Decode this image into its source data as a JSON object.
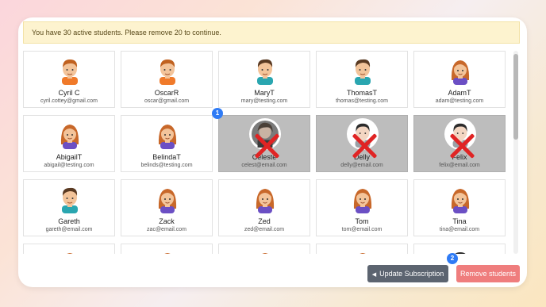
{
  "banner": {
    "text": "You have 30 active students. Please remove 20 to continue."
  },
  "students": [
    {
      "name": "Cyril C",
      "email": "cyril.cottey@gmail.com",
      "avatar": "boy-orange-avatar",
      "removed": false
    },
    {
      "name": "OscarR",
      "email": "oscar@gmail.com",
      "avatar": "boy-orange-avatar",
      "removed": false
    },
    {
      "name": "MaryT",
      "email": "mary@testing.com",
      "avatar": "boy-teal-avatar",
      "removed": false
    },
    {
      "name": "ThomasT",
      "email": "thomas@testing.com",
      "avatar": "boy-teal-avatar",
      "removed": false
    },
    {
      "name": "AdamT",
      "email": "adam@testing.com",
      "avatar": "girl-purple-avatar",
      "removed": false
    },
    {
      "name": "AbigailT",
      "email": "abigail@testing.com",
      "avatar": "girl-purple-avatar",
      "removed": false
    },
    {
      "name": "BelindaT",
      "email": "belinds@testing.com",
      "avatar": "girl-purple-avatar",
      "removed": false
    },
    {
      "name": "Celeste",
      "email": "celest@email.com",
      "avatar": "photo-avatar",
      "removed": true
    },
    {
      "name": "Delly",
      "email": "delly@email.com",
      "avatar": "boy-dark-avatar",
      "removed": true
    },
    {
      "name": "Felix",
      "email": "felix@email.com",
      "avatar": "boy-dark-avatar",
      "removed": true
    },
    {
      "name": "Gareth",
      "email": "gareth@email.com",
      "avatar": "boy-teal-avatar",
      "removed": false
    },
    {
      "name": "Zack",
      "email": "zac@email.com",
      "avatar": "girl-purple-avatar",
      "removed": false
    },
    {
      "name": "Zed",
      "email": "zed@email.com",
      "avatar": "girl-purple-avatar",
      "removed": false
    },
    {
      "name": "Tom",
      "email": "tom@email.com",
      "avatar": "girl-purple-avatar",
      "removed": false
    },
    {
      "name": "Tina",
      "email": "tina@email.com",
      "avatar": "girl-purple-avatar",
      "removed": false
    },
    {
      "name": "",
      "email": "",
      "avatar": "girl-purple-avatar",
      "removed": false
    },
    {
      "name": "",
      "email": "",
      "avatar": "girl-purple-avatar",
      "removed": false
    },
    {
      "name": "",
      "email": "",
      "avatar": "girl-purple-avatar",
      "removed": false
    },
    {
      "name": "",
      "email": "",
      "avatar": "girl-purple-avatar",
      "removed": false
    },
    {
      "name": "",
      "email": "",
      "avatar": "boy-dark-avatar",
      "removed": false
    }
  ],
  "badges": {
    "step1": "1",
    "step2": "2"
  },
  "buttons": {
    "update_label": "Update Subscription",
    "remove_label": "Remove students"
  },
  "colors": {
    "badge": "#2f7bf5",
    "remove_button": "#ef7d7d",
    "update_button": "#5c6470",
    "banner_bg": "#fdf3cf",
    "removed_x": "#e02424"
  }
}
